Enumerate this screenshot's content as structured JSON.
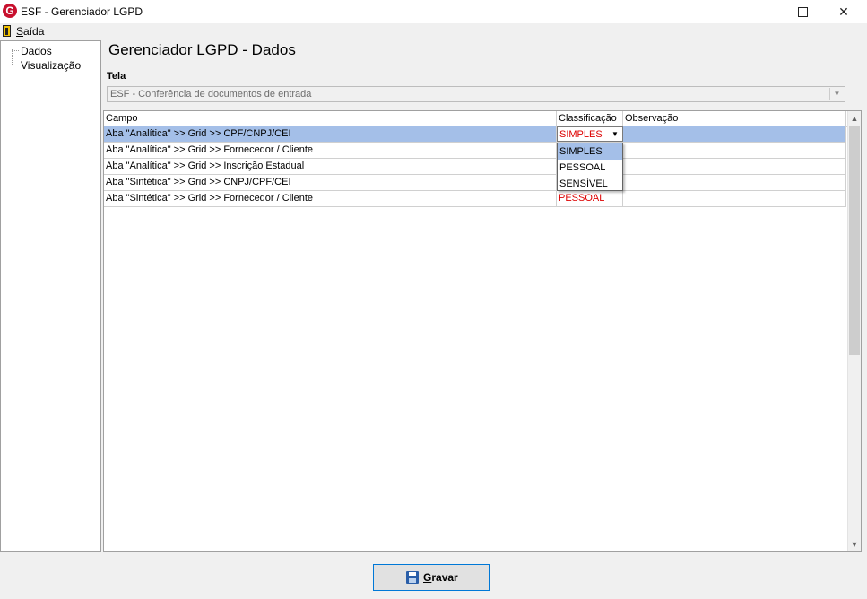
{
  "window": {
    "title": "ESF - Gerenciador LGPD",
    "logo_letter": "G",
    "minimize": "—",
    "close": "✕"
  },
  "menu": {
    "exit_first": "S",
    "exit_rest": "aída"
  },
  "tree": {
    "items": [
      {
        "label": "Dados"
      },
      {
        "label": "Visualização"
      }
    ]
  },
  "page": {
    "title": "Gerenciador LGPD - Dados",
    "tela_label": "Tela",
    "tela_value": "ESF - Conferência de documentos de entrada"
  },
  "grid": {
    "headers": [
      "Campo",
      "Classificação",
      "Observação"
    ],
    "rows": [
      {
        "campo": "Aba \"Analítica\" >> Grid >> CPF/CNPJ/CEI",
        "classificacao": "SIMPLES",
        "observacao": ""
      },
      {
        "campo": "Aba \"Analítica\" >> Grid >> Fornecedor / Cliente",
        "classificacao": "",
        "observacao": ""
      },
      {
        "campo": "Aba \"Analítica\" >> Grid >> Inscrição Estadual",
        "classificacao": "",
        "observacao": ""
      },
      {
        "campo": "Aba \"Sintética\" >> Grid >>  CNPJ/CPF/CEI",
        "classificacao": "",
        "observacao": ""
      },
      {
        "campo": "Aba \"Sintética\" >> Grid >> Fornecedor / Cliente",
        "classificacao": "PESSOAL",
        "observacao": ""
      }
    ],
    "dropdown_options": [
      "SIMPLES",
      "PESSOAL",
      "SENSÍVEL"
    ],
    "dropdown_highlighted": "SIMPLES"
  },
  "buttons": {
    "save_first": "G",
    "save_rest": "ravar"
  },
  "colors": {
    "selection": "#a4bfe8",
    "classification_text": "#dd0000",
    "button_border": "#0078d7",
    "logo": "#c8102e"
  },
  "icons": {
    "logo": "app-logo-icon",
    "exit": "exit-door-icon",
    "save": "floppy-disk-icon"
  }
}
